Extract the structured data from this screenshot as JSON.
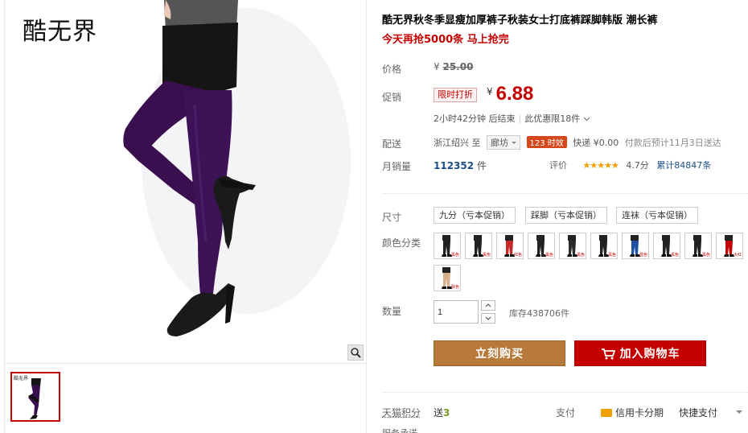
{
  "gallery": {
    "brand": "酷无界",
    "thumb_label": "酷无界"
  },
  "product": {
    "title": "酷无界秋冬季显瘦加厚裤子秋装女士打底裤踩脚韩版 潮长裤",
    "promo": "今天再抢5000条 马上抢完"
  },
  "price": {
    "label": "价格",
    "currency": "¥",
    "original": "25.00"
  },
  "promotion": {
    "label": "促销",
    "badge": "限时打折",
    "currency": "¥",
    "price": "6.88",
    "countdown": "2小时42分钟 后结束",
    "limit": "此优惠限18件"
  },
  "delivery": {
    "label": "配送",
    "from": "浙江绍兴 至",
    "to": "廊坊",
    "time_badge": "123 时效",
    "express": "快递 ¥0.00",
    "eta": "付款后预计11月3日送达"
  },
  "sales": {
    "label": "月销量",
    "count": "112352",
    "unit": "件",
    "review_label": "评价",
    "stars": "★★★★★",
    "score": "4.7分",
    "total": "累计84847条"
  },
  "size": {
    "label": "尺寸",
    "options": [
      "九分（亏本促销）",
      "踩脚（亏本促销）",
      "连袜（亏本促销）"
    ]
  },
  "color": {
    "label": "颜色分类",
    "swatches": [
      {
        "name": "黑色",
        "accent": "#222222"
      },
      {
        "name": "黑色",
        "accent": "#222222"
      },
      {
        "name": "红色",
        "accent": "#c62828"
      },
      {
        "name": "黑色",
        "accent": "#222222"
      },
      {
        "name": "黑色",
        "accent": "#2b2b2b"
      },
      {
        "name": "黑色",
        "accent": "#222222"
      },
      {
        "name": "蓝色",
        "accent": "#1e4fa0"
      },
      {
        "name": "黑色",
        "accent": "#222222"
      },
      {
        "name": "黑色",
        "accent": "#222222"
      },
      {
        "name": "大红",
        "accent": "#c40000"
      },
      {
        "name": "肤色",
        "accent": "#d9b08c"
      }
    ]
  },
  "quantity": {
    "label": "数量",
    "value": "1",
    "stock": "库存438706件"
  },
  "actions": {
    "buy": "立刻购买",
    "cart": "加入购物车"
  },
  "footer": {
    "points_label": "天猫积分",
    "points_prefix": "送",
    "points_value": "3",
    "pay_label": "支付",
    "pay_card": "信用卡分期",
    "pay_quick": "快捷支付",
    "service": "服务承诺"
  },
  "colors": {
    "accent_red": "#c40000",
    "buy_brown": "#b87a3a",
    "link_blue": "#1d4e87",
    "legging_purple": "#3a0f4f"
  }
}
